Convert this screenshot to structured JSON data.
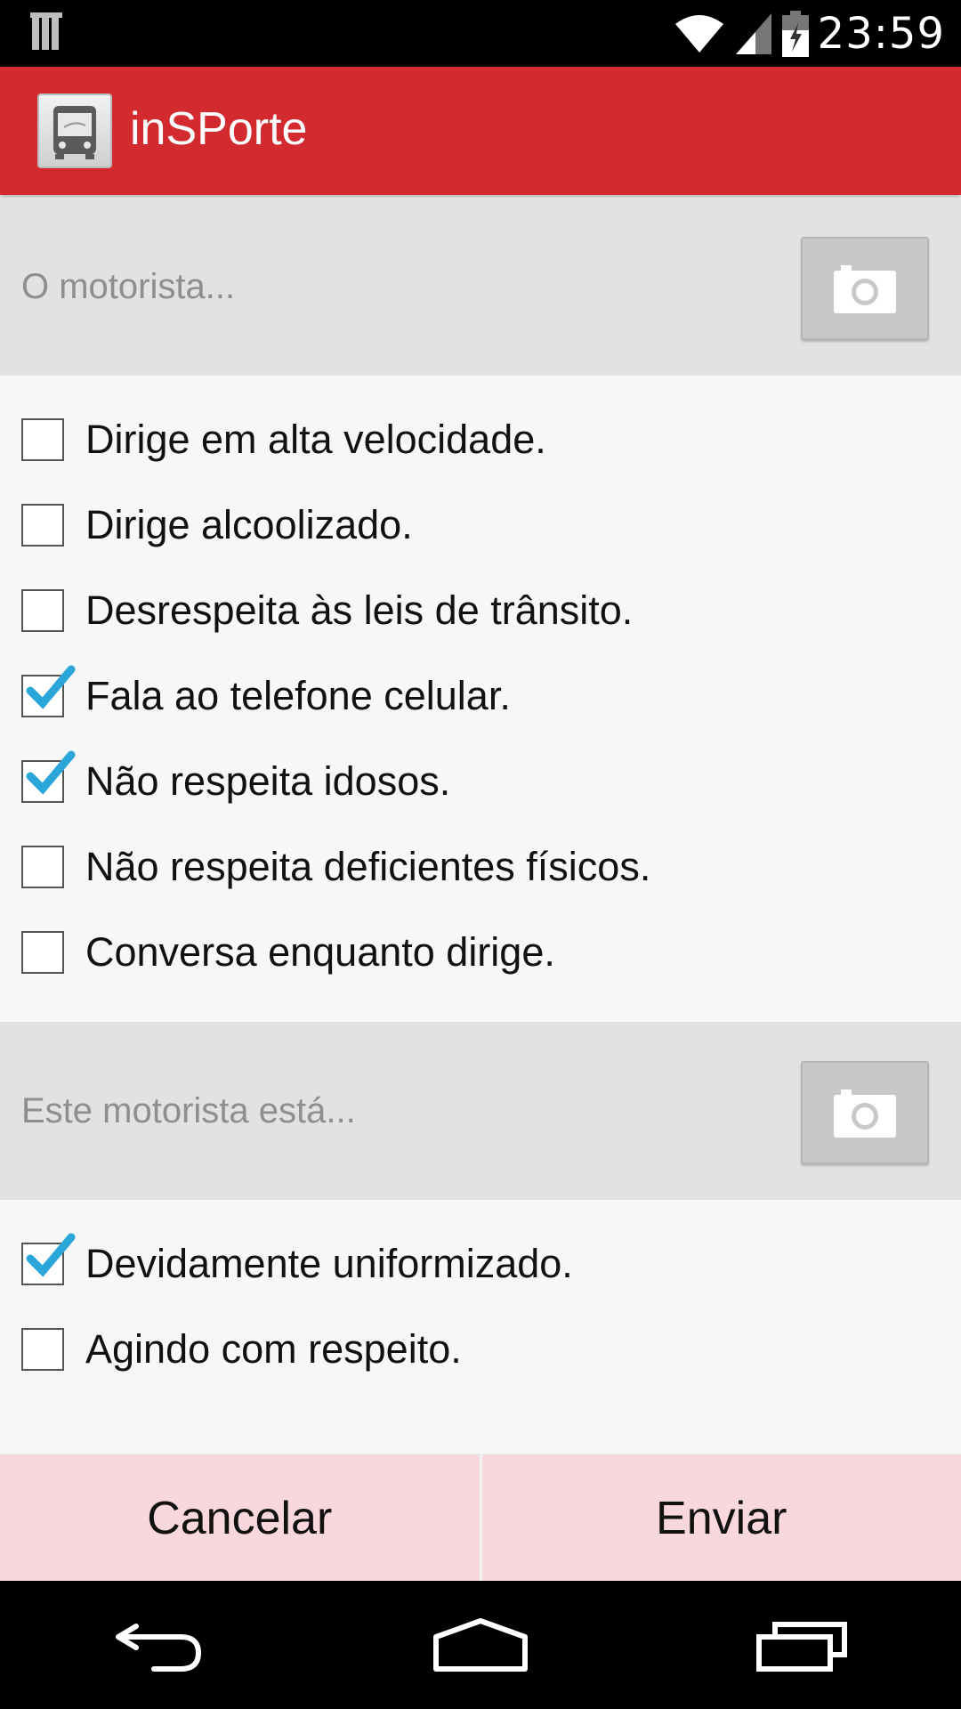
{
  "status_bar": {
    "time": "23:59"
  },
  "app_bar": {
    "title": "inSPorte"
  },
  "section1": {
    "hint": "O motorista...",
    "items": [
      {
        "label": "Dirige em alta velocidade.",
        "checked": false
      },
      {
        "label": "Dirige alcoolizado.",
        "checked": false
      },
      {
        "label": "Desrespeita às leis de trânsito.",
        "checked": false
      },
      {
        "label": "Fala ao telefone celular.",
        "checked": true
      },
      {
        "label": "Não respeita idosos.",
        "checked": true
      },
      {
        "label": "Não respeita deficientes físicos.",
        "checked": false
      },
      {
        "label": "Conversa enquanto dirige.",
        "checked": false
      }
    ]
  },
  "section2": {
    "hint": "Este motorista está...",
    "items": [
      {
        "label": "Devidamente uniformizado.",
        "checked": true
      },
      {
        "label": "Agindo com respeito.",
        "checked": false
      }
    ]
  },
  "buttons": {
    "cancel": "Cancelar",
    "send": "Enviar"
  },
  "colors": {
    "app_bar": "#d32a30",
    "checkmark": "#2aa6d9",
    "button_bg": "#f8d8dc"
  }
}
